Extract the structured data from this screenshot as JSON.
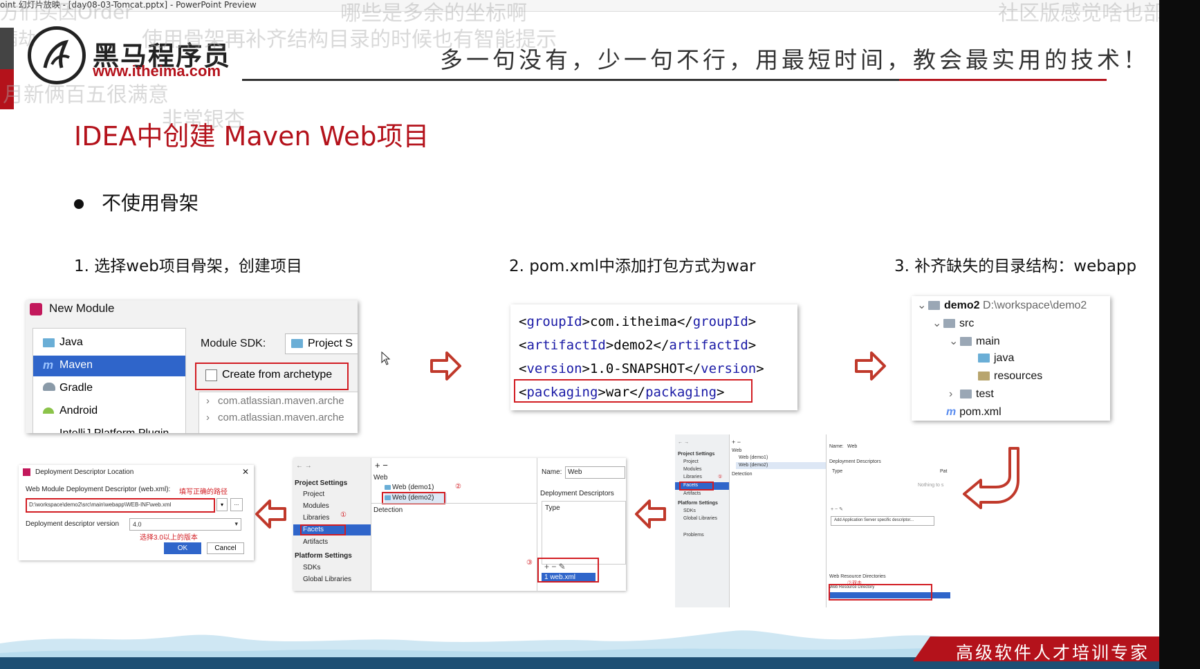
{
  "window": {
    "title": "oint 幻灯片放映 - [day08-03-Tomcat.pptx] - PowerPoint Preview"
  },
  "danmaku": [
    "方们买因Order",
    "哪些是多余的坐标啊",
    "社区版感觉啥也部没",
    "使用骨架再补齐结构目录的时候也有智能提示",
    "月新俩百五很满意",
    "非常银杏",
    "满劫"
  ],
  "header": {
    "logo_text": "黑马程序员",
    "logo_url": "www.itheima.com",
    "slogan": "多一句没有，少一句不行，用最短时间，教会最实用的技术！"
  },
  "slide": {
    "title": "IDEA中创建 Maven Web项目",
    "bullet": "不使用骨架",
    "steps": [
      "1. 选择web项目骨架，创建项目",
      "2. pom.xml中添加打包方式为war",
      "3. 补齐缺失的目录结构：webapp"
    ]
  },
  "new_module": {
    "title": "New Module",
    "types": [
      "Java",
      "Maven",
      "Gradle",
      "Android",
      "IntelliJ Platform Plugin"
    ],
    "sdk_label": "Module SDK:",
    "sdk_value": "Project S",
    "archetype_checkbox": "Create from archetype",
    "archetypes": [
      "com.atlassian.maven.arche",
      "com.atlassian.maven.arche"
    ]
  },
  "pom_code": [
    {
      "tag": "groupId",
      "value": "com.itheima"
    },
    {
      "tag": "artifactId",
      "value": "demo2"
    },
    {
      "tag": "version",
      "value": "1.0-SNAPSHOT"
    },
    {
      "tag": "packaging",
      "value": "war"
    }
  ],
  "project_tree": {
    "root": "demo2",
    "root_path": "D:\\workspace\\demo2",
    "items": [
      "src",
      "main",
      "java",
      "resources",
      "test",
      "pom.xml"
    ]
  },
  "descriptor_dialog": {
    "title": "Deployment Descriptor Location",
    "path_label": "Web Module Deployment Descriptor (web.xml):",
    "path_note": "填写正确的路径",
    "path_value": "D:\\workspace\\demo2\\src\\main\\webapp\\WEB-INF\\web.xml",
    "version_label": "Deployment descriptor version",
    "version_value": "4.0",
    "version_note": "选择3.0以上的版本",
    "ok": "OK",
    "cancel": "Cancel"
  },
  "facets_panel": {
    "project_settings": "Project Settings",
    "settings_items": [
      "Project",
      "Modules",
      "Libraries",
      "Facets",
      "Artifacts"
    ],
    "platform_settings": "Platform Settings",
    "platform_items": [
      "SDKs",
      "Global Libraries"
    ],
    "web": "Web",
    "web_items": [
      "Web (demo1)",
      "Web (demo2)"
    ],
    "detection": "Detection",
    "name_label": "Name:",
    "name_value": "Web",
    "descriptors": "Deployment Descriptors",
    "type": "Type",
    "webxml": "1  web.xml",
    "marks": [
      "①",
      "②",
      "③"
    ]
  },
  "small_panel": {
    "project_settings": "Project Settings",
    "items": [
      "Project",
      "Modules",
      "Libraries",
      "Facets",
      "Artifacts"
    ],
    "platform_settings": "Platform Settings",
    "platform_items": [
      "SDKs",
      "Global Libraries"
    ],
    "problems": "Problems",
    "web": "Web",
    "web_items": [
      "Web (demo1)",
      "Web (demo2)"
    ],
    "detection": "Detection",
    "name_label": "Name:",
    "name_value": "Web",
    "descriptors": "Deployment Descriptors",
    "type": "Type",
    "path_col": "Pat",
    "nothing": "Nothing to s",
    "add_server": "Add Application Server specific descriptor...",
    "web_resource": "Web Resource Directories",
    "web_resource_dir": "Web Resource Directory",
    "mark": "①",
    "double_click": "②双击"
  },
  "footer": {
    "tagline": "高级软件人才培训专家"
  },
  "colors": {
    "brand_red": "#b4121b",
    "xml_tag": "#1a1aa6",
    "selection": "#2f65ca",
    "footer_blue": "#1d4f74"
  }
}
